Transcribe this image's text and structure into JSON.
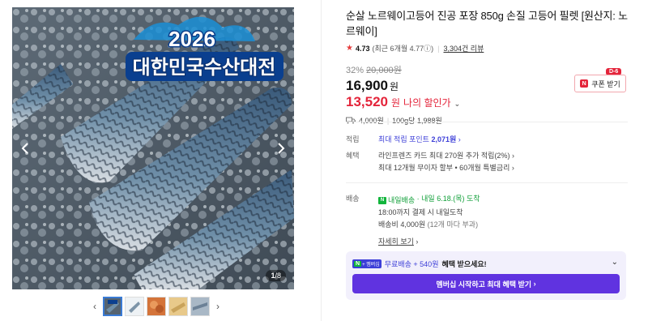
{
  "gallery": {
    "banner_year": "2026",
    "banner_title": "대한민국수산대전",
    "counter_current": "1",
    "counter_total": "/8"
  },
  "product": {
    "title": "순살 노르웨이고등어 진공 포장 850g 손질 고등어 필렛 [원산지: 노르웨이]",
    "rating": "4.73",
    "recent_rating": "(최근 6개월 4.77ⓘ)",
    "reviews": "3,304건 리뷰",
    "discount_rate": "32%",
    "original_price": "20,000원",
    "price": "16,900",
    "price_unit": "원",
    "my_price": "13,520",
    "my_price_unit": "원",
    "my_price_label": "나의 할인가",
    "shipping_fee": "4,000원",
    "unit_price": "100g당 1,988원"
  },
  "coupon": {
    "label": "쿠폰 받기",
    "dday": "D-6",
    "n": "N"
  },
  "points": {
    "key": "적립",
    "value_prefix": "최대 적립 포인트",
    "value_amount": "2,071원"
  },
  "benefits": {
    "key": "혜택",
    "line1": "라인프렌즈 카드 최대 270원 추가 적립(2%)",
    "line2": "최대 12개월 무이자 할부 • 60개월 특별금리"
  },
  "delivery": {
    "key": "배송",
    "badge": "N",
    "badge_text": "내일배송",
    "arrival": "· 내일 6.18.(목) 도착",
    "line2": "18:00까지 결제 시 내일도착",
    "fee": "배송비 4,000원",
    "fee_note": "(12개 마다 부과)",
    "detail_link": "자세히 보기"
  },
  "membership": {
    "n": "N",
    "plus": "+ 멤버십",
    "free_shipping": "무료배송 + 540원",
    "suffix": "혜택 받으세요!",
    "button": "멤버십 시작하고 최대 혜택 받기"
  },
  "colors": {
    "accent_red": "#e4243a",
    "naver_green": "#12b53c",
    "purple": "#6033e0",
    "link_blue": "#3d3fd8"
  }
}
